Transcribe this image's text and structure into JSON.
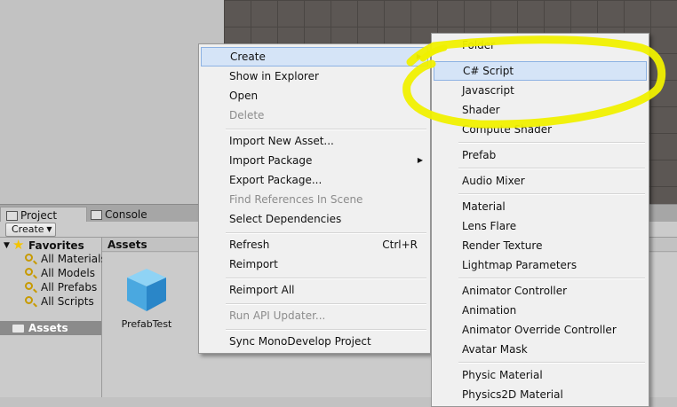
{
  "tabs": {
    "project": "Project",
    "console": "Console"
  },
  "toolbar": {
    "create_label": "Create"
  },
  "tree": {
    "favorites_label": "Favorites",
    "items": [
      "All Materials",
      "All Models",
      "All Prefabs",
      "All Scripts"
    ],
    "assets_label": "Assets"
  },
  "assets_panel": {
    "header": "Assets",
    "asset_name": "PrefabTest"
  },
  "context_menu": [
    {
      "label": "Create",
      "submenu": true,
      "highlighted": true
    },
    {
      "label": "Show in Explorer"
    },
    {
      "label": "Open"
    },
    {
      "label": "Delete",
      "disabled": true
    },
    {
      "label": "Import New Asset..."
    },
    {
      "label": "Import Package",
      "submenu": true
    },
    {
      "label": "Export Package..."
    },
    {
      "label": "Find References In Scene",
      "disabled": true
    },
    {
      "label": "Select Dependencies"
    },
    {
      "label": "Refresh",
      "shortcut": "Ctrl+R"
    },
    {
      "label": "Reimport"
    },
    {
      "label": "Reimport All"
    },
    {
      "label": "Run API Updater...",
      "disabled": true
    },
    {
      "label": "Sync MonoDevelop Project"
    }
  ],
  "create_submenu": [
    "Folder",
    "C# Script",
    "Javascript",
    "Shader",
    "Compute Shader",
    "Prefab",
    "Audio Mixer",
    "Material",
    "Lens Flare",
    "Render Texture",
    "Lightmap Parameters",
    "Animator Controller",
    "Animation",
    "Animator Override Controller",
    "Avatar Mask",
    "Physic Material",
    "Physics2D Material"
  ],
  "colors": {
    "highlighter": "#f0f000",
    "menu_highlight": "#d5e4f7",
    "scene": "#5c5754"
  }
}
